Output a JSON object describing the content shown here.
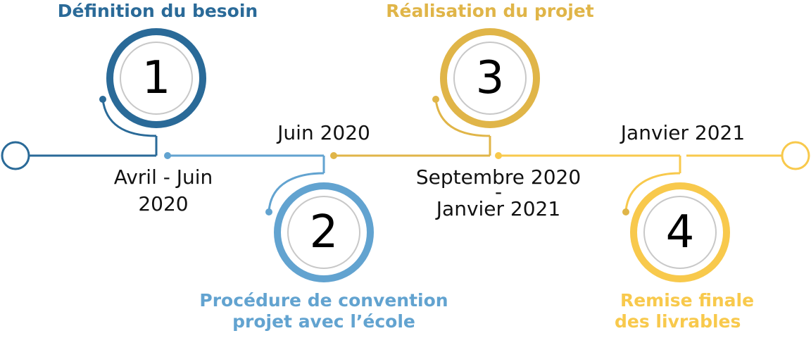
{
  "colors": {
    "step1": "#2a6a98",
    "step2": "#62a3d0",
    "step3": "#e0b548",
    "step4": "#f8c94c",
    "inner_ring": "#c8c8c8"
  },
  "steps": [
    {
      "number": "1",
      "title": "Définition du besoin",
      "date": "Avril - Juin 2020"
    },
    {
      "number": "2",
      "title_line1": "Procédure de convention",
      "title_line2": "projet avec l’école",
      "date": "Juin 2020"
    },
    {
      "number": "3",
      "title": "Réalisation du projet",
      "date_line1": "Septembre 2020",
      "date_sep": "-",
      "date_line2": "Janvier 2021"
    },
    {
      "number": "4",
      "title_line1": "Remise finale",
      "title_line2": "des livrables",
      "date": "Janvier 2021"
    }
  ],
  "date_labels": {
    "step1_line1": "Avril - Juin",
    "step1_line2": "2020"
  }
}
